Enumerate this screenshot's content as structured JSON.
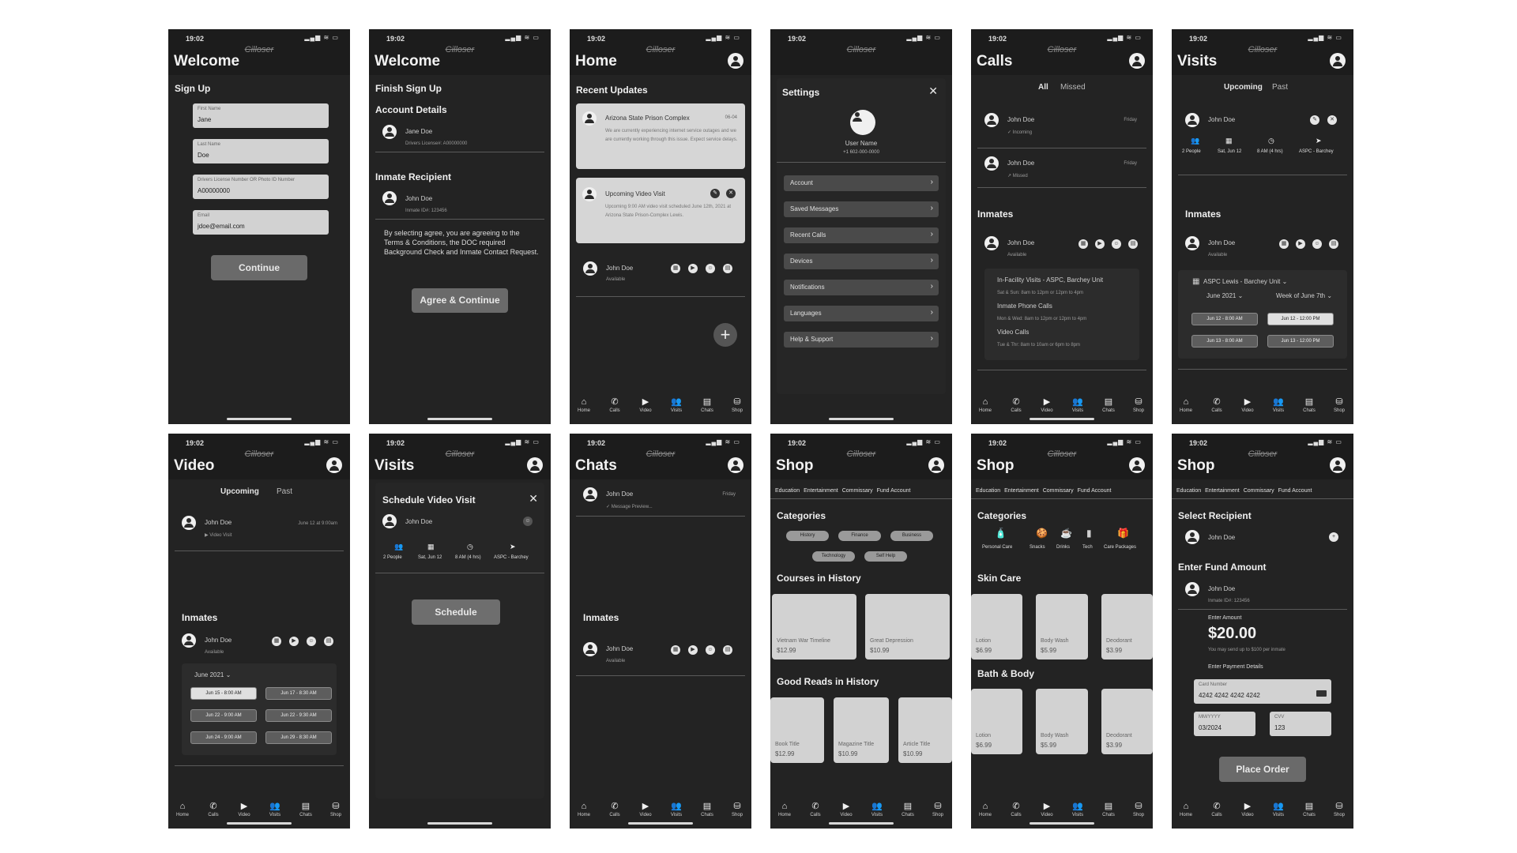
{
  "common": {
    "time": "19:02",
    "status_icons": "▂▄▆ ≋ ▭",
    "brand": "Cilloser",
    "tabs": [
      {
        "icon": "⌂",
        "label": "Home"
      },
      {
        "icon": "✆",
        "label": "Calls"
      },
      {
        "icon": "▶",
        "label": "Video"
      },
      {
        "icon": "👥",
        "label": "Visits"
      },
      {
        "icon": "▤",
        "label": "Chats"
      },
      {
        "icon": "⛁",
        "label": "Shop"
      }
    ]
  },
  "s1": {
    "title": "Welcome",
    "section": "Sign Up",
    "fields": [
      {
        "label": "First Name",
        "value": "Jane"
      },
      {
        "label": "Last Name",
        "value": "Doe"
      },
      {
        "label": "Drivers License Number OR Photo ID Number",
        "value": "A00000000"
      },
      {
        "label": "Email",
        "value": "jdoe@email.com"
      }
    ],
    "button": "Continue"
  },
  "s2": {
    "title": "Welcome",
    "section": "Finish Sign Up",
    "account_header": "Account Details",
    "account_name": "Jane Doe",
    "account_sub": "Drivers License#: A00000000",
    "inmate_header": "Inmate Recipient",
    "inmate_name": "John Doe",
    "inmate_sub": "Inmate ID#: 123456",
    "agreement": "By selecting agree, you are agreeing to the Terms & Conditions, the DOC required Background Check and Inmate Contact Request.",
    "button": "Agree & Continue"
  },
  "s3": {
    "title": "Home",
    "section": "Recent Updates",
    "card1_title": "Arizona State Prison Complex",
    "card1_date": "06-04",
    "card1_body": "We are currently experiencing internet service outages and we are currently working through this issue. Expect service delays.",
    "card2_title": "Upcoming Video Visit",
    "card2_body": "Upcoming 9:00 AM video visit scheduled June 12th, 2021 at Arizona State Prison-Complex Lewis.",
    "contact_name": "John Doe",
    "contact_sub": "Available",
    "fab": "+"
  },
  "s4": {
    "title": "Settings",
    "user_name": "User Name",
    "phone": "+1 602-000-0000",
    "menu": [
      "Account",
      "Saved Messages",
      "Recent Calls",
      "Devices",
      "Notifications",
      "Languages",
      "Help & Support"
    ]
  },
  "s5": {
    "title": "Calls",
    "seg_all": "All",
    "seg_missed": "Missed",
    "calls": [
      {
        "name": "John Doe",
        "sub": "✓ Incoming",
        "day": "Friday"
      },
      {
        "name": "John Doe",
        "sub": "↗ Missed",
        "day": "Friday"
      }
    ],
    "inmates_header": "Inmates",
    "inmate_name": "John Doe",
    "inmate_sub": "Available",
    "info_title": "In-Facility Visits - ASPC, Barchey Unit",
    "info_1": "Sat & Sun: 8am to 12pm or 12pm to 4pm",
    "info_h2": "Inmate Phone Calls",
    "info_2": "Mon & Wed: 8am to 12pm or 12pm to 4pm",
    "info_h3": "Video Calls",
    "info_3": "Tue & Thr: 8am to 10am or 6pm to 8pm"
  },
  "s6": {
    "title": "Visits",
    "seg_upcoming": "Upcoming",
    "seg_past": "Past",
    "visit_name": "John Doe",
    "details": [
      "2 People",
      "Sat, Jun 12",
      "8 AM (4 hrs)",
      "ASPC - Barchey"
    ],
    "inmates_header": "Inmates",
    "inmate_name": "John Doe",
    "inmate_sub": "Available",
    "facility": "ASPC Lewis - Barchey Unit ⌄",
    "month": "June 2021 ⌄",
    "week": "Week of June 7th ⌄",
    "slots": [
      "Jun 12 - 8:00 AM",
      "Jun 12 - 12:00 PM",
      "Jun 13 - 8:00 AM",
      "Jun 13 - 12:00 PM"
    ]
  },
  "s7": {
    "title": "Video",
    "seg_upcoming": "Upcoming",
    "seg_past": "Past",
    "visit_name": "John Doe",
    "visit_sub": "▶ Video Visit",
    "visit_date": "June 12 at 9:00am",
    "inmates_header": "Inmates",
    "inmate_name": "John Doe",
    "inmate_sub": "Available",
    "month": "June 2021 ⌄",
    "slots": [
      "Jun 15 - 8:00 AM",
      "Jun 17 - 8:30 AM",
      "Jun 22 - 9:00 AM",
      "Jun 22 - 9:30 AM",
      "Jun 24 - 9:00 AM",
      "Jun 29 - 8:30 AM"
    ]
  },
  "s8": {
    "title": "Visits",
    "modal_title": "Schedule Video Visit",
    "name": "John Doe",
    "details": [
      "2 People",
      "Sat, Jun 12",
      "8 AM (4 hrs)",
      "ASPC - Barchey"
    ],
    "button": "Schedule"
  },
  "s9": {
    "title": "Chats",
    "chat_name": "John Doe",
    "chat_preview": "✓ Message Preview...",
    "chat_day": "Friday",
    "inmates_header": "Inmates",
    "inmate_name": "John Doe",
    "inmate_sub": "Available"
  },
  "s10": {
    "title": "Shop",
    "tabs": [
      "Education",
      "Entertainment",
      "Commissary",
      "Fund Account"
    ],
    "categories_header": "Categories",
    "pills": [
      "History",
      "Finance",
      "Business",
      "Technology",
      "Self Help"
    ],
    "courses_header": "Courses in History",
    "courses": [
      {
        "name": "Vietnam War Timeline",
        "price": "$12.99"
      },
      {
        "name": "Great Depression",
        "price": "$10.99"
      }
    ],
    "reads_header": "Good Reads in History",
    "reads": [
      {
        "name": "Book Title",
        "price": "$12.99"
      },
      {
        "name": "Magazine Title",
        "price": "$10.99"
      },
      {
        "name": "Article Title",
        "price": "$10.99"
      }
    ]
  },
  "s11": {
    "title": "Shop",
    "tabs": [
      "Education",
      "Entertainment",
      "Commissary",
      "Fund Account"
    ],
    "categories_header": "Categories",
    "cats": [
      {
        "icon": "🧴",
        "label": "Personal Care"
      },
      {
        "icon": "🍪",
        "label": "Snacks"
      },
      {
        "icon": "☕",
        "label": "Drinks"
      },
      {
        "icon": "▮",
        "label": "Tech"
      },
      {
        "icon": "🎁",
        "label": "Care Packages"
      }
    ],
    "skin_header": "Skin Care",
    "skin": [
      {
        "name": "Lotion",
        "price": "$6.99"
      },
      {
        "name": "Body Wash",
        "price": "$5.99"
      },
      {
        "name": "Deodorant",
        "price": "$3.99"
      }
    ],
    "bath_header": "Bath & Body",
    "bath": [
      {
        "name": "Lotion",
        "price": "$6.99"
      },
      {
        "name": "Body Wash",
        "price": "$5.99"
      },
      {
        "name": "Deodorant",
        "price": "$3.99"
      }
    ]
  },
  "s12": {
    "title": "Shop",
    "tabs": [
      "Education",
      "Entertainment",
      "Commissary",
      "Fund Account"
    ],
    "recipient_header": "Select Recipient",
    "recipient_name": "John Doe",
    "fund_header": "Enter Fund Amount",
    "fund_name": "John Doe",
    "fund_sub": "Inmate ID#: 123456",
    "amount_label": "Enter Amount",
    "amount": "$20.00",
    "limit_note": "You may send up to $100 per inmate",
    "payment_label": "Enter Payment Details",
    "card_label": "Card Number",
    "card_value": "4242 4242 4242 4242",
    "exp_label": "MM/YYYY",
    "exp_value": "03/2024",
    "cvv_label": "CVV",
    "cvv_value": "123",
    "button": "Place Order"
  }
}
